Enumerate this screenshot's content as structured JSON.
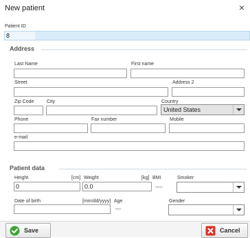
{
  "window": {
    "title": "New patient",
    "close_glyph": "×"
  },
  "patient_id": {
    "label": "Patient ID",
    "value": "8"
  },
  "address": {
    "title": "Address",
    "last_name_label": "Last Name",
    "first_name_label": "First name",
    "street_label": "Street",
    "address2_label": "Address 2",
    "zip_label": "Zip Code",
    "city_label": "City",
    "country_label": "Country",
    "country_value": "United States",
    "phone_label": "Phone",
    "fax_label": "Fax number",
    "mobile_label": "Mobile",
    "email_label": "e-mail"
  },
  "patient_data": {
    "title": "Patient data",
    "height_label": "Height",
    "height_unit": "[cm]",
    "weight_label": "Weight",
    "weight_unit": "[kg]",
    "bmi_label": "BMI",
    "bmi_value": "----",
    "smoker_label": "Smoker",
    "height_value": "0",
    "weight_value": "0.0",
    "dob_label": "Date of birth",
    "dob_format": "[mm/dd/yyyy]",
    "age_label": "Age",
    "age_value": "---",
    "gender_label": "Gender"
  },
  "buttons": {
    "save": "Save",
    "cancel": "Cancel"
  },
  "colors": {
    "save_icon": "#3fa535",
    "cancel_icon": "#d8322a",
    "group_title": "#555555"
  },
  "icons": {
    "save": "check-circle-icon",
    "cancel": "close-box-icon",
    "close": "close-icon",
    "dropdown": "chevron-down-icon"
  }
}
